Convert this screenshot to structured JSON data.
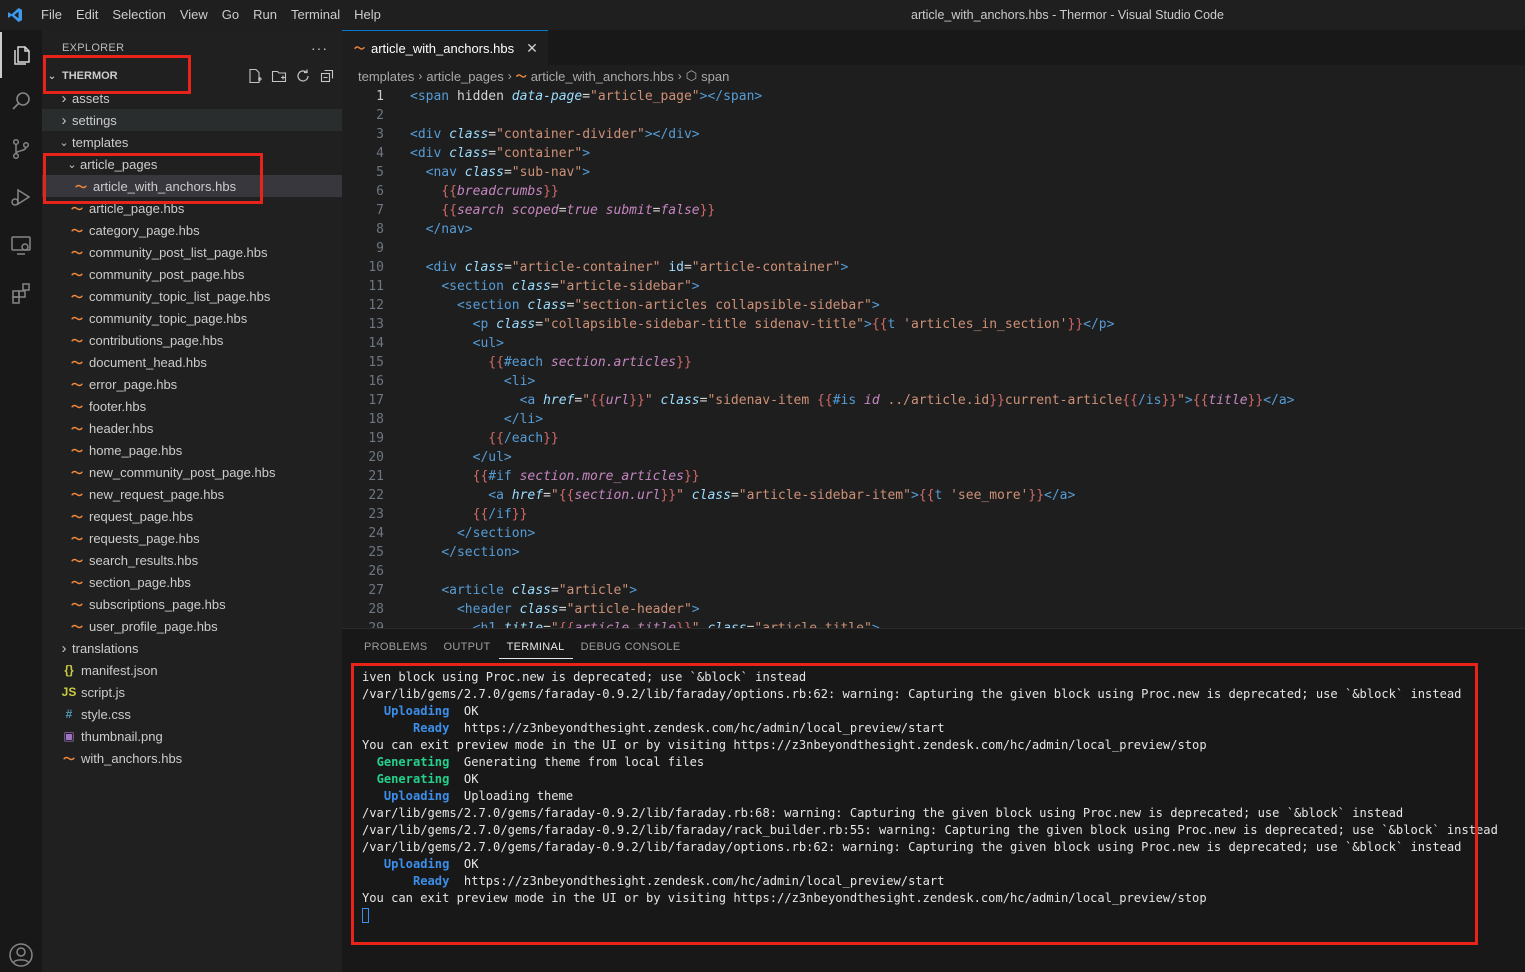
{
  "window": {
    "title": "article_with_anchors.hbs - Thermor - Visual Studio Code",
    "menu": [
      "File",
      "Edit",
      "Selection",
      "View",
      "Go",
      "Run",
      "Terminal",
      "Help"
    ]
  },
  "activity_bar": {
    "items": [
      "explorer-icon",
      "search-icon",
      "source-control-icon",
      "run-debug-icon",
      "remote-explorer-icon",
      "extensions-icon",
      "account-icon"
    ]
  },
  "sidebar": {
    "header": "EXPLORER",
    "more": "···",
    "workspace": "THERMOR",
    "tree": [
      {
        "label": "assets",
        "type": "folder",
        "depth": 1,
        "expanded": false
      },
      {
        "label": "settings",
        "type": "folder",
        "depth": 1,
        "expanded": false
      },
      {
        "label": "templates",
        "type": "folder",
        "depth": 1,
        "expanded": true
      },
      {
        "label": "article_pages",
        "type": "folder",
        "depth": 2,
        "expanded": true
      },
      {
        "label": "article_with_anchors.hbs",
        "type": "hbs",
        "depth": 3,
        "selected": true
      },
      {
        "label": "article_page.hbs",
        "type": "hbs",
        "depth": 2
      },
      {
        "label": "category_page.hbs",
        "type": "hbs",
        "depth": 2
      },
      {
        "label": "community_post_list_page.hbs",
        "type": "hbs",
        "depth": 2
      },
      {
        "label": "community_post_page.hbs",
        "type": "hbs",
        "depth": 2
      },
      {
        "label": "community_topic_list_page.hbs",
        "type": "hbs",
        "depth": 2
      },
      {
        "label": "community_topic_page.hbs",
        "type": "hbs",
        "depth": 2
      },
      {
        "label": "contributions_page.hbs",
        "type": "hbs",
        "depth": 2
      },
      {
        "label": "document_head.hbs",
        "type": "hbs",
        "depth": 2
      },
      {
        "label": "error_page.hbs",
        "type": "hbs",
        "depth": 2
      },
      {
        "label": "footer.hbs",
        "type": "hbs",
        "depth": 2
      },
      {
        "label": "header.hbs",
        "type": "hbs",
        "depth": 2
      },
      {
        "label": "home_page.hbs",
        "type": "hbs",
        "depth": 2
      },
      {
        "label": "new_community_post_page.hbs",
        "type": "hbs",
        "depth": 2
      },
      {
        "label": "new_request_page.hbs",
        "type": "hbs",
        "depth": 2
      },
      {
        "label": "request_page.hbs",
        "type": "hbs",
        "depth": 2
      },
      {
        "label": "requests_page.hbs",
        "type": "hbs",
        "depth": 2
      },
      {
        "label": "search_results.hbs",
        "type": "hbs",
        "depth": 2
      },
      {
        "label": "section_page.hbs",
        "type": "hbs",
        "depth": 2
      },
      {
        "label": "subscriptions_page.hbs",
        "type": "hbs",
        "depth": 2
      },
      {
        "label": "user_profile_page.hbs",
        "type": "hbs",
        "depth": 2
      },
      {
        "label": "translations",
        "type": "folder",
        "depth": 1,
        "expanded": false
      },
      {
        "label": "manifest.json",
        "type": "json",
        "depth": 1
      },
      {
        "label": "script.js",
        "type": "js",
        "depth": 1
      },
      {
        "label": "style.css",
        "type": "css",
        "depth": 1
      },
      {
        "label": "thumbnail.png",
        "type": "png",
        "depth": 1
      },
      {
        "label": "with_anchors.hbs",
        "type": "hbs",
        "depth": 1
      }
    ]
  },
  "editor": {
    "tab": "article_with_anchors.hbs",
    "breadcrumbs": [
      "templates",
      "article_pages",
      "article_with_anchors.hbs",
      "span"
    ],
    "current_line": 1,
    "lines": [
      [
        [
          "t",
          "<span "
        ],
        [
          "p",
          "hidden "
        ],
        [
          "a",
          "data-page"
        ],
        [
          "p",
          "="
        ],
        [
          "s",
          "\"article_page\""
        ],
        [
          "t",
          "></span>"
        ]
      ],
      [],
      [
        [
          "t",
          "<div "
        ],
        [
          "a",
          "class"
        ],
        [
          "p",
          "="
        ],
        [
          "s",
          "\"container-divider\""
        ],
        [
          "t",
          "></div>"
        ]
      ],
      [
        [
          "t",
          "<div "
        ],
        [
          "a",
          "class"
        ],
        [
          "p",
          "="
        ],
        [
          "s",
          "\"container\""
        ],
        [
          "t",
          ">"
        ]
      ],
      [
        [
          "p",
          "  "
        ],
        [
          "t",
          "<nav "
        ],
        [
          "a",
          "class"
        ],
        [
          "p",
          "="
        ],
        [
          "s",
          "\"sub-nav\""
        ],
        [
          "t",
          ">"
        ]
      ],
      [
        [
          "p",
          "    "
        ],
        [
          "b",
          "{{"
        ],
        [
          "v",
          "breadcrumbs"
        ],
        [
          "b",
          "}}"
        ]
      ],
      [
        [
          "p",
          "    "
        ],
        [
          "b",
          "{{"
        ],
        [
          "v",
          "search scoped"
        ],
        [
          "p",
          "="
        ],
        [
          "v",
          "true submit"
        ],
        [
          "p",
          "="
        ],
        [
          "v",
          "false"
        ],
        [
          "b",
          "}}"
        ]
      ],
      [
        [
          "p",
          "  "
        ],
        [
          "t",
          "</nav>"
        ]
      ],
      [],
      [
        [
          "p",
          "  "
        ],
        [
          "t",
          "<div "
        ],
        [
          "a",
          "class"
        ],
        [
          "p",
          "="
        ],
        [
          "s",
          "\"article-container\" "
        ],
        [
          "a2",
          "id"
        ],
        [
          "p",
          "="
        ],
        [
          "s",
          "\"article-container\""
        ],
        [
          "t",
          ">"
        ]
      ],
      [
        [
          "p",
          "    "
        ],
        [
          "t",
          "<section "
        ],
        [
          "a",
          "class"
        ],
        [
          "p",
          "="
        ],
        [
          "s",
          "\"article-sidebar\""
        ],
        [
          "t",
          ">"
        ]
      ],
      [
        [
          "p",
          "      "
        ],
        [
          "t",
          "<section "
        ],
        [
          "a",
          "class"
        ],
        [
          "p",
          "="
        ],
        [
          "s",
          "\"section-articles collapsible-sidebar\""
        ],
        [
          "t",
          ">"
        ]
      ],
      [
        [
          "p",
          "        "
        ],
        [
          "t",
          "<p "
        ],
        [
          "a",
          "class"
        ],
        [
          "p",
          "="
        ],
        [
          "s",
          "\"collapsible-sidebar-title sidenav-title\""
        ],
        [
          "t",
          ">"
        ],
        [
          "b",
          "{{"
        ],
        [
          "t",
          "t "
        ],
        [
          "s",
          "'articles_in_section'"
        ],
        [
          "b",
          "}}"
        ],
        [
          "t",
          "</p>"
        ]
      ],
      [
        [
          "p",
          "        "
        ],
        [
          "t",
          "<ul>"
        ]
      ],
      [
        [
          "p",
          "          "
        ],
        [
          "b",
          "{{"
        ],
        [
          "t",
          "#each "
        ],
        [
          "v",
          "section.articles"
        ],
        [
          "b",
          "}}"
        ]
      ],
      [
        [
          "p",
          "            "
        ],
        [
          "t",
          "<li>"
        ]
      ],
      [
        [
          "p",
          "              "
        ],
        [
          "t",
          "<a "
        ],
        [
          "a",
          "href"
        ],
        [
          "p",
          "="
        ],
        [
          "s",
          "\""
        ],
        [
          "b",
          "{{"
        ],
        [
          "v",
          "url"
        ],
        [
          "b",
          "}}"
        ],
        [
          "s",
          "\" "
        ],
        [
          "a",
          "class"
        ],
        [
          "p",
          "="
        ],
        [
          "s",
          "\"sidenav-item "
        ],
        [
          "b",
          "{{"
        ],
        [
          "t",
          "#is "
        ],
        [
          "v",
          "id"
        ],
        [
          "s",
          " ../article.id"
        ],
        [
          "b",
          "}}"
        ],
        [
          "s",
          "current-article"
        ],
        [
          "b",
          "{{"
        ],
        [
          "t",
          "/is"
        ],
        [
          "b",
          "}}"
        ],
        [
          "s",
          "\""
        ],
        [
          "t",
          ">"
        ],
        [
          "b",
          "{{"
        ],
        [
          "v",
          "title"
        ],
        [
          "b",
          "}}"
        ],
        [
          "t",
          "</a>"
        ]
      ],
      [
        [
          "p",
          "            "
        ],
        [
          "t",
          "</li>"
        ]
      ],
      [
        [
          "p",
          "          "
        ],
        [
          "b",
          "{{"
        ],
        [
          "t",
          "/each"
        ],
        [
          "b",
          "}}"
        ]
      ],
      [
        [
          "p",
          "        "
        ],
        [
          "t",
          "</ul>"
        ]
      ],
      [
        [
          "p",
          "        "
        ],
        [
          "b",
          "{{"
        ],
        [
          "t",
          "#if "
        ],
        [
          "v",
          "section.more_articles"
        ],
        [
          "b",
          "}}"
        ]
      ],
      [
        [
          "p",
          "          "
        ],
        [
          "t",
          "<a "
        ],
        [
          "a",
          "href"
        ],
        [
          "p",
          "="
        ],
        [
          "s",
          "\""
        ],
        [
          "b",
          "{{"
        ],
        [
          "v",
          "section.url"
        ],
        [
          "b",
          "}}"
        ],
        [
          "s",
          "\" "
        ],
        [
          "a",
          "class"
        ],
        [
          "p",
          "="
        ],
        [
          "s",
          "\"article-sidebar-item\""
        ],
        [
          "t",
          ">"
        ],
        [
          "b",
          "{{"
        ],
        [
          "t",
          "t "
        ],
        [
          "s",
          "'see_more'"
        ],
        [
          "b",
          "}}"
        ],
        [
          "t",
          "</a>"
        ]
      ],
      [
        [
          "p",
          "        "
        ],
        [
          "b",
          "{{"
        ],
        [
          "t",
          "/if"
        ],
        [
          "b",
          "}}"
        ]
      ],
      [
        [
          "p",
          "      "
        ],
        [
          "t",
          "</section>"
        ]
      ],
      [
        [
          "p",
          "    "
        ],
        [
          "t",
          "</section>"
        ]
      ],
      [],
      [
        [
          "p",
          "    "
        ],
        [
          "t",
          "<article "
        ],
        [
          "a",
          "class"
        ],
        [
          "p",
          "="
        ],
        [
          "s",
          "\"article\""
        ],
        [
          "t",
          ">"
        ]
      ],
      [
        [
          "p",
          "      "
        ],
        [
          "t",
          "<header "
        ],
        [
          "a",
          "class"
        ],
        [
          "p",
          "="
        ],
        [
          "s",
          "\"article-header\""
        ],
        [
          "t",
          ">"
        ]
      ],
      [
        [
          "p",
          "        "
        ],
        [
          "t",
          "<h1 "
        ],
        [
          "a",
          "title"
        ],
        [
          "p",
          "="
        ],
        [
          "s",
          "\""
        ],
        [
          "b",
          "{{"
        ],
        [
          "v",
          "article.title"
        ],
        [
          "b",
          "}}"
        ],
        [
          "s",
          "\" "
        ],
        [
          "a",
          "class"
        ],
        [
          "p",
          "="
        ],
        [
          "s",
          "\"article-title\""
        ],
        [
          "t",
          ">"
        ]
      ]
    ]
  },
  "panel": {
    "tabs": [
      "PROBLEMS",
      "OUTPUT",
      "TERMINAL",
      "DEBUG CONSOLE"
    ],
    "active_tab": "TERMINAL",
    "terminal": [
      [
        [
          "plain",
          "iven block using Proc.new is deprecated; use `&block` instead"
        ]
      ],
      [
        [
          "plain",
          "/var/lib/gems/2.7.0/gems/faraday-0.9.2/lib/faraday/options.rb:62: warning: Capturing the given block using Proc.new is deprecated; use `&block` instead"
        ]
      ],
      [
        [
          "plain",
          "   "
        ],
        [
          "blue",
          "Uploading"
        ],
        [
          "plain",
          "  OK"
        ]
      ],
      [
        [
          "plain",
          "       "
        ],
        [
          "blue",
          "Ready"
        ],
        [
          "plain",
          "  https://z3nbeyondthesight.zendesk.com/hc/admin/local_preview/start"
        ]
      ],
      [
        [
          "plain",
          "You can exit preview mode in the UI or by visiting https://z3nbeyondthesight.zendesk.com/hc/admin/local_preview/stop"
        ]
      ],
      [
        [
          "plain",
          "  "
        ],
        [
          "green",
          "Generating"
        ],
        [
          "plain",
          "  Generating theme from local files"
        ]
      ],
      [
        [
          "plain",
          "  "
        ],
        [
          "green",
          "Generating"
        ],
        [
          "plain",
          "  OK"
        ]
      ],
      [
        [
          "plain",
          "   "
        ],
        [
          "blue",
          "Uploading"
        ],
        [
          "plain",
          "  Uploading theme"
        ]
      ],
      [
        [
          "plain",
          "/var/lib/gems/2.7.0/gems/faraday-0.9.2/lib/faraday.rb:68: warning: Capturing the given block using Proc.new is deprecated; use `&block` instead"
        ]
      ],
      [
        [
          "plain",
          "/var/lib/gems/2.7.0/gems/faraday-0.9.2/lib/faraday/rack_builder.rb:55: warning: Capturing the given block using Proc.new is deprecated; use `&block` instead"
        ]
      ],
      [
        [
          "plain",
          "/var/lib/gems/2.7.0/gems/faraday-0.9.2/lib/faraday/options.rb:62: warning: Capturing the given block using Proc.new is deprecated; use `&block` instead"
        ]
      ],
      [
        [
          "plain",
          "   "
        ],
        [
          "blue",
          "Uploading"
        ],
        [
          "plain",
          "  OK"
        ]
      ],
      [
        [
          "plain",
          "       "
        ],
        [
          "blue",
          "Ready"
        ],
        [
          "plain",
          "  https://z3nbeyondthesight.zendesk.com/hc/admin/local_preview/start"
        ]
      ],
      [
        [
          "plain",
          "You can exit preview mode in the UI or by visiting https://z3nbeyondthesight.zendesk.com/hc/admin/local_preview/stop"
        ]
      ]
    ]
  },
  "colors": {
    "annotation": "#e8231a",
    "accent": "#0078d4",
    "hbs_icon": "#f0883e"
  }
}
